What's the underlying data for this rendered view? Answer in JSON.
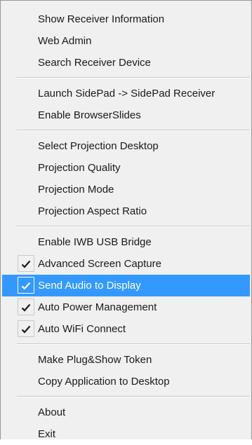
{
  "menu": {
    "groups": [
      {
        "items": [
          {
            "label": "Show Receiver Information",
            "checked": false
          },
          {
            "label": "Web Admin",
            "checked": false
          },
          {
            "label": "Search Receiver Device",
            "checked": false
          }
        ]
      },
      {
        "items": [
          {
            "label": "Launch SidePad -> SidePad Receiver",
            "checked": false
          },
          {
            "label": "Enable BrowserSlides",
            "checked": false
          }
        ]
      },
      {
        "items": [
          {
            "label": "Select Projection Desktop",
            "checked": false
          },
          {
            "label": "Projection Quality",
            "checked": false
          },
          {
            "label": "Projection Mode",
            "checked": false
          },
          {
            "label": "Projection Aspect Ratio",
            "checked": false
          }
        ]
      },
      {
        "items": [
          {
            "label": "Enable IWB USB Bridge",
            "checked": false
          },
          {
            "label": "Advanced Screen Capture",
            "checked": true
          },
          {
            "label": "Send Audio to Display",
            "checked": true,
            "highlighted": true
          },
          {
            "label": "Auto Power Management",
            "checked": true
          },
          {
            "label": "Auto WiFi Connect",
            "checked": true
          }
        ]
      },
      {
        "items": [
          {
            "label": "Make Plug&Show Token",
            "checked": false
          },
          {
            "label": "Copy Application to Desktop",
            "checked": false
          }
        ]
      },
      {
        "items": [
          {
            "label": "About",
            "checked": false
          },
          {
            "label": "Exit",
            "checked": false
          }
        ]
      }
    ],
    "highlight_color": "#3399ff",
    "check_icon": "checkmark-icon"
  }
}
